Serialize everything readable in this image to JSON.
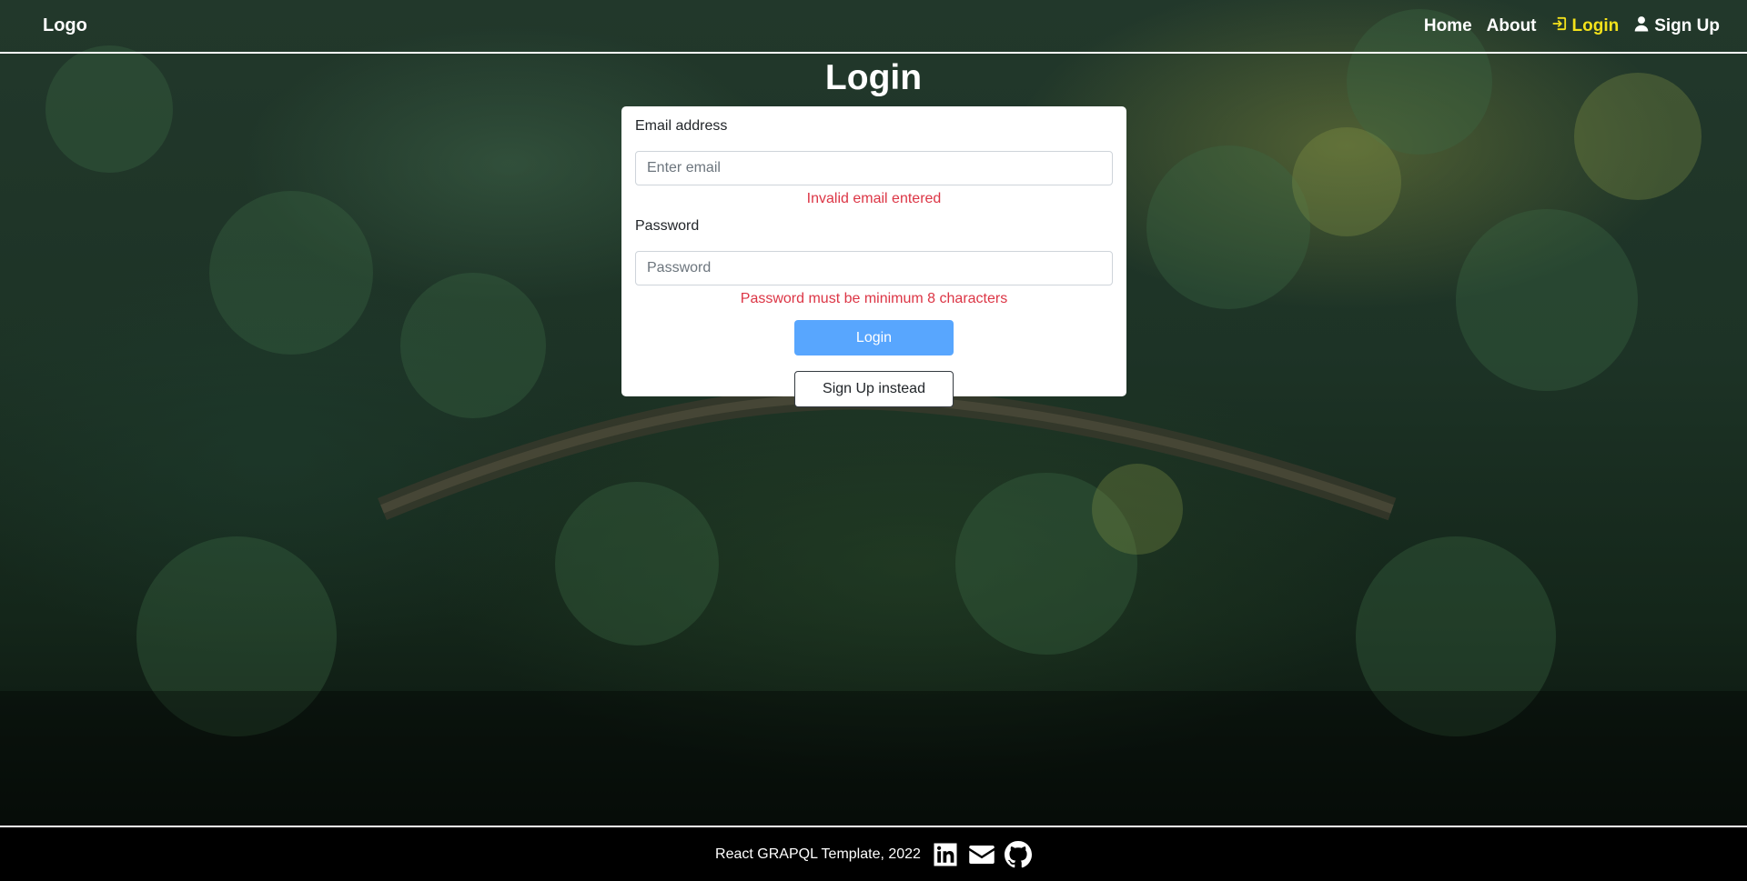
{
  "header": {
    "logo": "Logo",
    "nav": {
      "home": "Home",
      "about": "About",
      "login": "Login",
      "signup": "Sign Up"
    },
    "active_color": "#f4e21b"
  },
  "page": {
    "title": "Login"
  },
  "form": {
    "email_label": "Email address",
    "email_placeholder": "Enter email",
    "email_value": "",
    "email_error": "Invalid email entered",
    "password_label": "Password",
    "password_placeholder": "Password",
    "password_value": "",
    "password_error": "Password must be minimum 8 characters",
    "login_button": "Login",
    "signup_button": "Sign Up instead"
  },
  "footer": {
    "text": "React GRAPQL Template, 2022",
    "icons": [
      "linkedin-icon",
      "email-icon",
      "github-icon"
    ]
  },
  "colors": {
    "primary_button": "#58a6fe",
    "error": "#dc3545"
  }
}
